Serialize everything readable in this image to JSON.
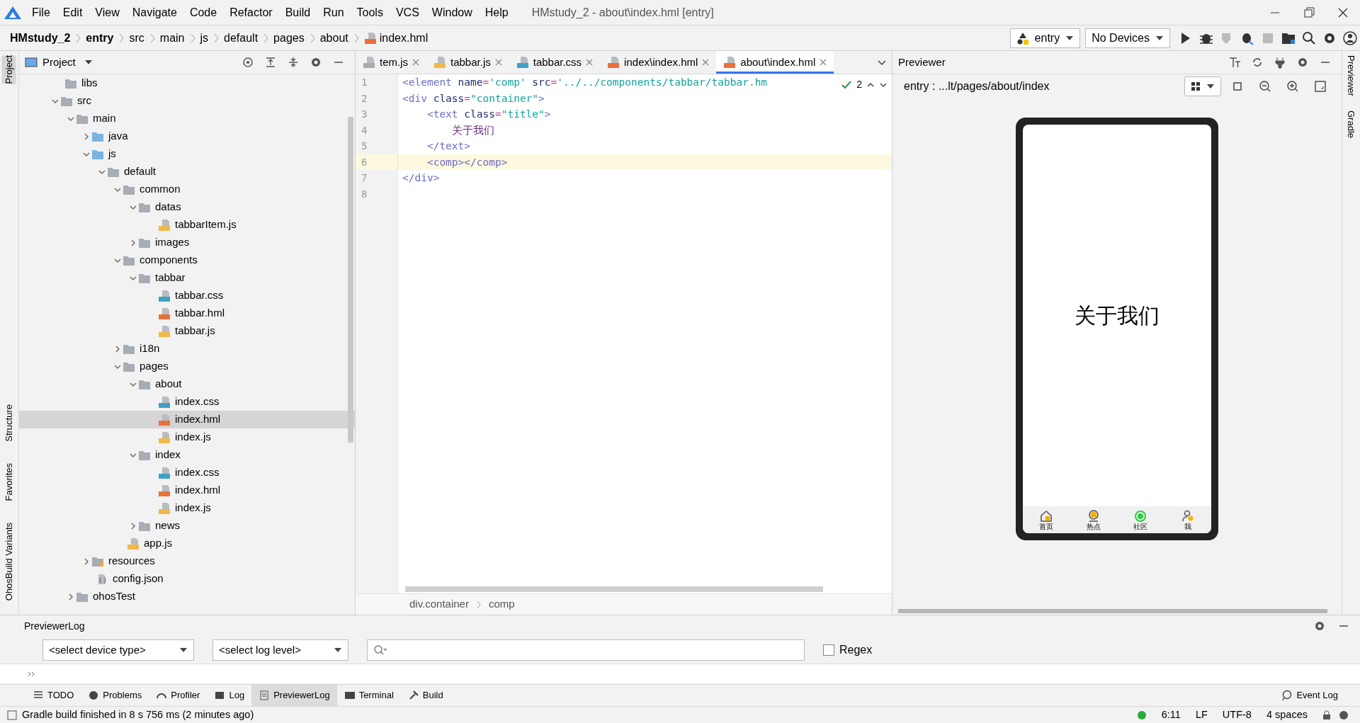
{
  "window": {
    "title": "HMstudy_2 - about\\index.hml [entry]"
  },
  "menu": [
    "File",
    "Edit",
    "View",
    "Navigate",
    "Code",
    "Refactor",
    "Build",
    "Run",
    "Tools",
    "VCS",
    "Window",
    "Help"
  ],
  "breadcrumbs": [
    {
      "text": "HMstudy_2",
      "kind": "module"
    },
    {
      "text": "entry",
      "kind": "module"
    },
    {
      "text": "src",
      "kind": "dir"
    },
    {
      "text": "main",
      "kind": "dir"
    },
    {
      "text": "js",
      "kind": "dir"
    },
    {
      "text": "default",
      "kind": "dir"
    },
    {
      "text": "pages",
      "kind": "dir"
    },
    {
      "text": "about",
      "kind": "dir"
    },
    {
      "text": "index.hml",
      "kind": "file"
    }
  ],
  "toolbar": {
    "module": "entry",
    "device": "No Devices"
  },
  "left_stripe": [
    {
      "label": "Project",
      "selected": true
    },
    {
      "label": "Structure",
      "selected": false
    },
    {
      "label": "Favorites",
      "selected": false
    },
    {
      "label": "OhosBuild Variants",
      "selected": false
    }
  ],
  "right_stripe": [
    {
      "label": "Previewer",
      "selected": false
    },
    {
      "label": "Gradle",
      "selected": false
    }
  ],
  "project": {
    "title": "Project",
    "tree": [
      {
        "name": "libs",
        "kind": "folder",
        "selected": false
      },
      {
        "name": "src",
        "kind": "folder",
        "expanded": true,
        "selected": false,
        "children": [
          {
            "name": "main",
            "kind": "folder",
            "expanded": true,
            "selected": false,
            "children": [
              {
                "name": "java",
                "kind": "srcfolder",
                "expanded": false,
                "selected": false
              },
              {
                "name": "js",
                "kind": "srcfolder",
                "expanded": true,
                "selected": false,
                "children": [
                  {
                    "name": "default",
                    "kind": "folder",
                    "expanded": true,
                    "selected": false,
                    "children": [
                      {
                        "name": "common",
                        "kind": "folder",
                        "expanded": true,
                        "selected": false,
                        "children": [
                          {
                            "name": "datas",
                            "kind": "folder",
                            "expanded": true,
                            "selected": false,
                            "children": [
                              {
                                "name": "tabbarItem.js",
                                "kind": "js",
                                "selected": false
                              }
                            ]
                          },
                          {
                            "name": "images",
                            "kind": "folder",
                            "expanded": false,
                            "selected": false
                          }
                        ]
                      },
                      {
                        "name": "components",
                        "kind": "folder",
                        "expanded": true,
                        "selected": false,
                        "children": [
                          {
                            "name": "tabbar",
                            "kind": "folder",
                            "expanded": true,
                            "selected": false,
                            "children": [
                              {
                                "name": "tabbar.css",
                                "kind": "css",
                                "selected": false
                              },
                              {
                                "name": "tabbar.hml",
                                "kind": "hml",
                                "selected": false
                              },
                              {
                                "name": "tabbar.js",
                                "kind": "js",
                                "selected": false
                              }
                            ]
                          }
                        ]
                      },
                      {
                        "name": "i18n",
                        "kind": "folder",
                        "expanded": false,
                        "selected": false
                      },
                      {
                        "name": "pages",
                        "kind": "folder",
                        "expanded": true,
                        "selected": false,
                        "children": [
                          {
                            "name": "about",
                            "kind": "folder",
                            "expanded": true,
                            "selected": false,
                            "children": [
                              {
                                "name": "index.css",
                                "kind": "css",
                                "selected": false
                              },
                              {
                                "name": "index.hml",
                                "kind": "hml",
                                "selected": true
                              },
                              {
                                "name": "index.js",
                                "kind": "js",
                                "selected": false
                              }
                            ]
                          },
                          {
                            "name": "index",
                            "kind": "folder",
                            "expanded": true,
                            "selected": false,
                            "children": [
                              {
                                "name": "index.css",
                                "kind": "css",
                                "selected": false
                              },
                              {
                                "name": "index.hml",
                                "kind": "hml",
                                "selected": false
                              },
                              {
                                "name": "index.js",
                                "kind": "js",
                                "selected": false
                              }
                            ]
                          },
                          {
                            "name": "news",
                            "kind": "folder",
                            "expanded": false,
                            "selected": false
                          }
                        ]
                      },
                      {
                        "name": "app.js",
                        "kind": "js",
                        "selected": false
                      }
                    ]
                  }
                ]
              },
              {
                "name": "resources",
                "kind": "resfolder",
                "expanded": false,
                "selected": false
              },
              {
                "name": "config.json",
                "kind": "json",
                "selected": false
              }
            ]
          },
          {
            "name": "ohosTest",
            "kind": "folder",
            "expanded": false,
            "selected": false
          }
        ]
      }
    ]
  },
  "editor": {
    "tabs": [
      {
        "label": "tem.js",
        "kind": "none",
        "selected": false
      },
      {
        "label": "tabbar.js",
        "kind": "js",
        "selected": false
      },
      {
        "label": "tabbar.css",
        "kind": "css",
        "selected": false
      },
      {
        "label": "index\\index.hml",
        "kind": "hml",
        "selected": false
      },
      {
        "label": "about\\index.hml",
        "kind": "hml",
        "selected": true
      }
    ],
    "inspection_count": "2",
    "lines": [
      {
        "number": "1",
        "current": false,
        "tokens": [
          {
            "kind": "tag",
            "text": "<element"
          },
          {
            "kind": "attr",
            "text": " name"
          },
          {
            "kind": "eq",
            "text": "="
          },
          {
            "kind": "val",
            "text": "'comp'"
          },
          {
            "kind": "attr",
            "text": " src"
          },
          {
            "kind": "eq",
            "text": "="
          },
          {
            "kind": "val",
            "text": "'../../components/tabbar/tabbar.hm"
          }
        ]
      },
      {
        "number": "2",
        "current": false,
        "tokens": [
          {
            "kind": "tag",
            "text": "<div"
          },
          {
            "kind": "attr",
            "text": " class"
          },
          {
            "kind": "eq",
            "text": "="
          },
          {
            "kind": "val",
            "text": "\"container\""
          },
          {
            "kind": "tag",
            "text": ">"
          }
        ]
      },
      {
        "number": "3",
        "current": false,
        "tokens": [
          {
            "kind": "tag",
            "text": "    <text"
          },
          {
            "kind": "attr",
            "text": " class"
          },
          {
            "kind": "eq",
            "text": "="
          },
          {
            "kind": "val",
            "text": "\"title\""
          },
          {
            "kind": "tag",
            "text": ">"
          }
        ]
      },
      {
        "number": "4",
        "current": false,
        "tokens": [
          {
            "kind": "text",
            "text": "        关于我们"
          }
        ]
      },
      {
        "number": "5",
        "current": false,
        "tokens": [
          {
            "kind": "tag",
            "text": "    </text>"
          }
        ]
      },
      {
        "number": "6",
        "current": true,
        "tokens": [
          {
            "kind": "tag",
            "text": "    <comp></comp>"
          }
        ]
      },
      {
        "number": "7",
        "current": false,
        "tokens": [
          {
            "kind": "tag",
            "text": "</div>"
          }
        ]
      },
      {
        "number": "8",
        "current": false
      }
    ],
    "footer": [
      "div.container",
      "comp"
    ]
  },
  "previewer": {
    "title": "Previewer",
    "path": "entry : ...lt/pages/about/index",
    "screen_text": "关于我们",
    "nav": [
      {
        "label": "首页",
        "kind": "home",
        "color": "#f2b300"
      },
      {
        "label": "热点",
        "kind": "spot",
        "color": "#f2b300"
      },
      {
        "label": "社区",
        "kind": "globe",
        "color": "#2ecc40"
      },
      {
        "label": "我",
        "kind": "person",
        "color": "#f2b300"
      }
    ]
  },
  "log": {
    "title": "PreviewerLog",
    "device_select": "<select device type>",
    "level_select": "<select log level>",
    "regex": {
      "label": "Regex",
      "checked": false
    }
  },
  "tool_tabs": [
    {
      "label": "TODO",
      "kind": "list",
      "selected": false
    },
    {
      "label": "Problems",
      "kind": "info",
      "selected": false
    },
    {
      "label": "Profiler",
      "kind": "gauge",
      "selected": false
    },
    {
      "label": "Log",
      "kind": "log",
      "selected": false
    },
    {
      "label": "PreviewerLog",
      "kind": "doc",
      "selected": true
    },
    {
      "label": "Terminal",
      "kind": "term",
      "selected": false
    },
    {
      "label": "Build",
      "kind": "hammer",
      "selected": false
    }
  ],
  "event_log": "Event Log",
  "status_bar": {
    "message": "Gradle build finished in 8 s 756 ms (2 minutes ago)",
    "position": "6:11",
    "line_sep": "LF",
    "encoding": "UTF-8",
    "indent": "4 spaces"
  }
}
